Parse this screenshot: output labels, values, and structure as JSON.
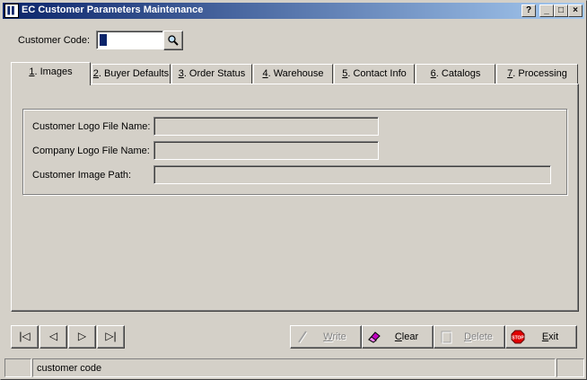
{
  "window": {
    "title": "EC Customer Parameters Maintenance",
    "help_button": "?",
    "minimize_button": "_",
    "maximize_button": "□",
    "close_button": "×"
  },
  "customer_code": {
    "label": "Customer Code:",
    "value": ""
  },
  "tabs": [
    {
      "key": "1",
      "label": ". Images",
      "active": true
    },
    {
      "key": "2",
      "label": ". Buyer Defaults"
    },
    {
      "key": "3",
      "label": ". Order Status"
    },
    {
      "key": "4",
      "label": ". Warehouse"
    },
    {
      "key": "5",
      "label": ". Contact Info"
    },
    {
      "key": "6",
      "label": ". Catalogs"
    },
    {
      "key": "7",
      "label": ". Processing"
    }
  ],
  "images_tab": {
    "customer_logo_label": "Customer Logo File Name:",
    "customer_logo_value": "",
    "company_logo_label": "Company Logo File Name:",
    "company_logo_value": "",
    "customer_image_path_label": "Customer Image Path:",
    "customer_image_path_value": ""
  },
  "nav": {
    "first": "|◁",
    "prev": "◁",
    "next": "▷",
    "last": "▷|"
  },
  "actions": {
    "write_key": "W",
    "write_rest": "rite",
    "clear_key": "C",
    "clear_rest": "lear",
    "delete_key": "D",
    "delete_rest": "elete",
    "exit_key": "E",
    "exit_rest": "xit",
    "stop_sign_text": "STOP"
  },
  "status": {
    "message": "customer code"
  },
  "colors": {
    "title_start": "#0a246a",
    "title_end": "#a6caf0",
    "face": "#d4d0c8",
    "selection": "#0a246a"
  }
}
